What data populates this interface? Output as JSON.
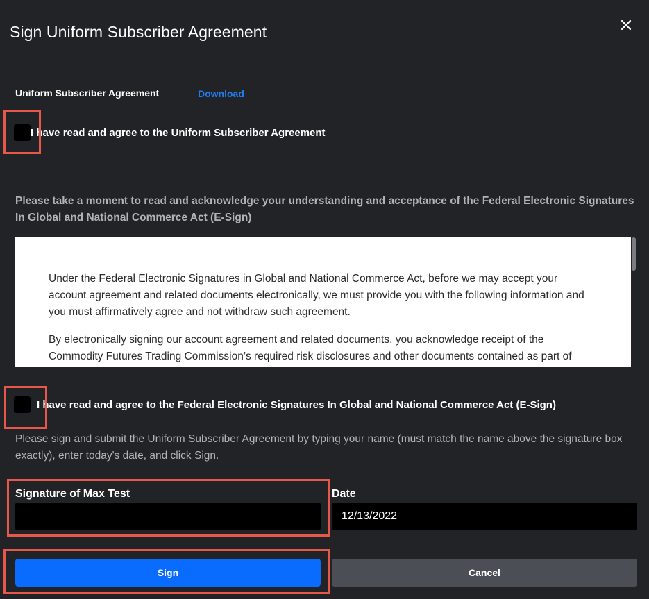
{
  "dialog": {
    "title": "Sign Uniform Subscriber Agreement",
    "close_icon": "close-icon"
  },
  "agreement": {
    "label": "Uniform Subscriber Agreement",
    "download_label": "Download",
    "checkbox_label": "I have read and agree to the Uniform Subscriber Agreement",
    "checked": false
  },
  "esign": {
    "intro": "Please take a moment to read and acknowledge your understanding and acceptance of the Federal Electronic Signatures In Global and National Commerce Act (E-Sign)",
    "paragraphs": [
      "Under the Federal Electronic Signatures in Global and National Commerce Act, before we may accept your account agreement and related documents electronically, we must provide you with the following information and you must affirmatively agree and not withdraw such agreement.",
      "By electronically signing our account agreement and related documents, you acknowledge receipt of the Commodity Futures Trading Commission’s required risk disclosures and other documents contained as part of"
    ],
    "checkbox_label": "I have read and agree to the Federal Electronic Signatures In Global and National Commerce Act (E-Sign)",
    "checked": false
  },
  "signing": {
    "instructions": "Please sign and submit the Uniform Subscriber Agreement by typing your name (must match the name above the signature box exactly), enter today's date, and click Sign.",
    "signature_label": "Signature of Max Test",
    "signature_value": "",
    "date_label": "Date",
    "date_value": "12/13/2022"
  },
  "actions": {
    "sign_label": "Sign",
    "cancel_label": "Cancel"
  },
  "colors": {
    "background": "#222326",
    "accent": "#0a6cff",
    "link": "#1f7cf0",
    "highlight": "#e8584a",
    "cancel": "#4b4e55"
  }
}
